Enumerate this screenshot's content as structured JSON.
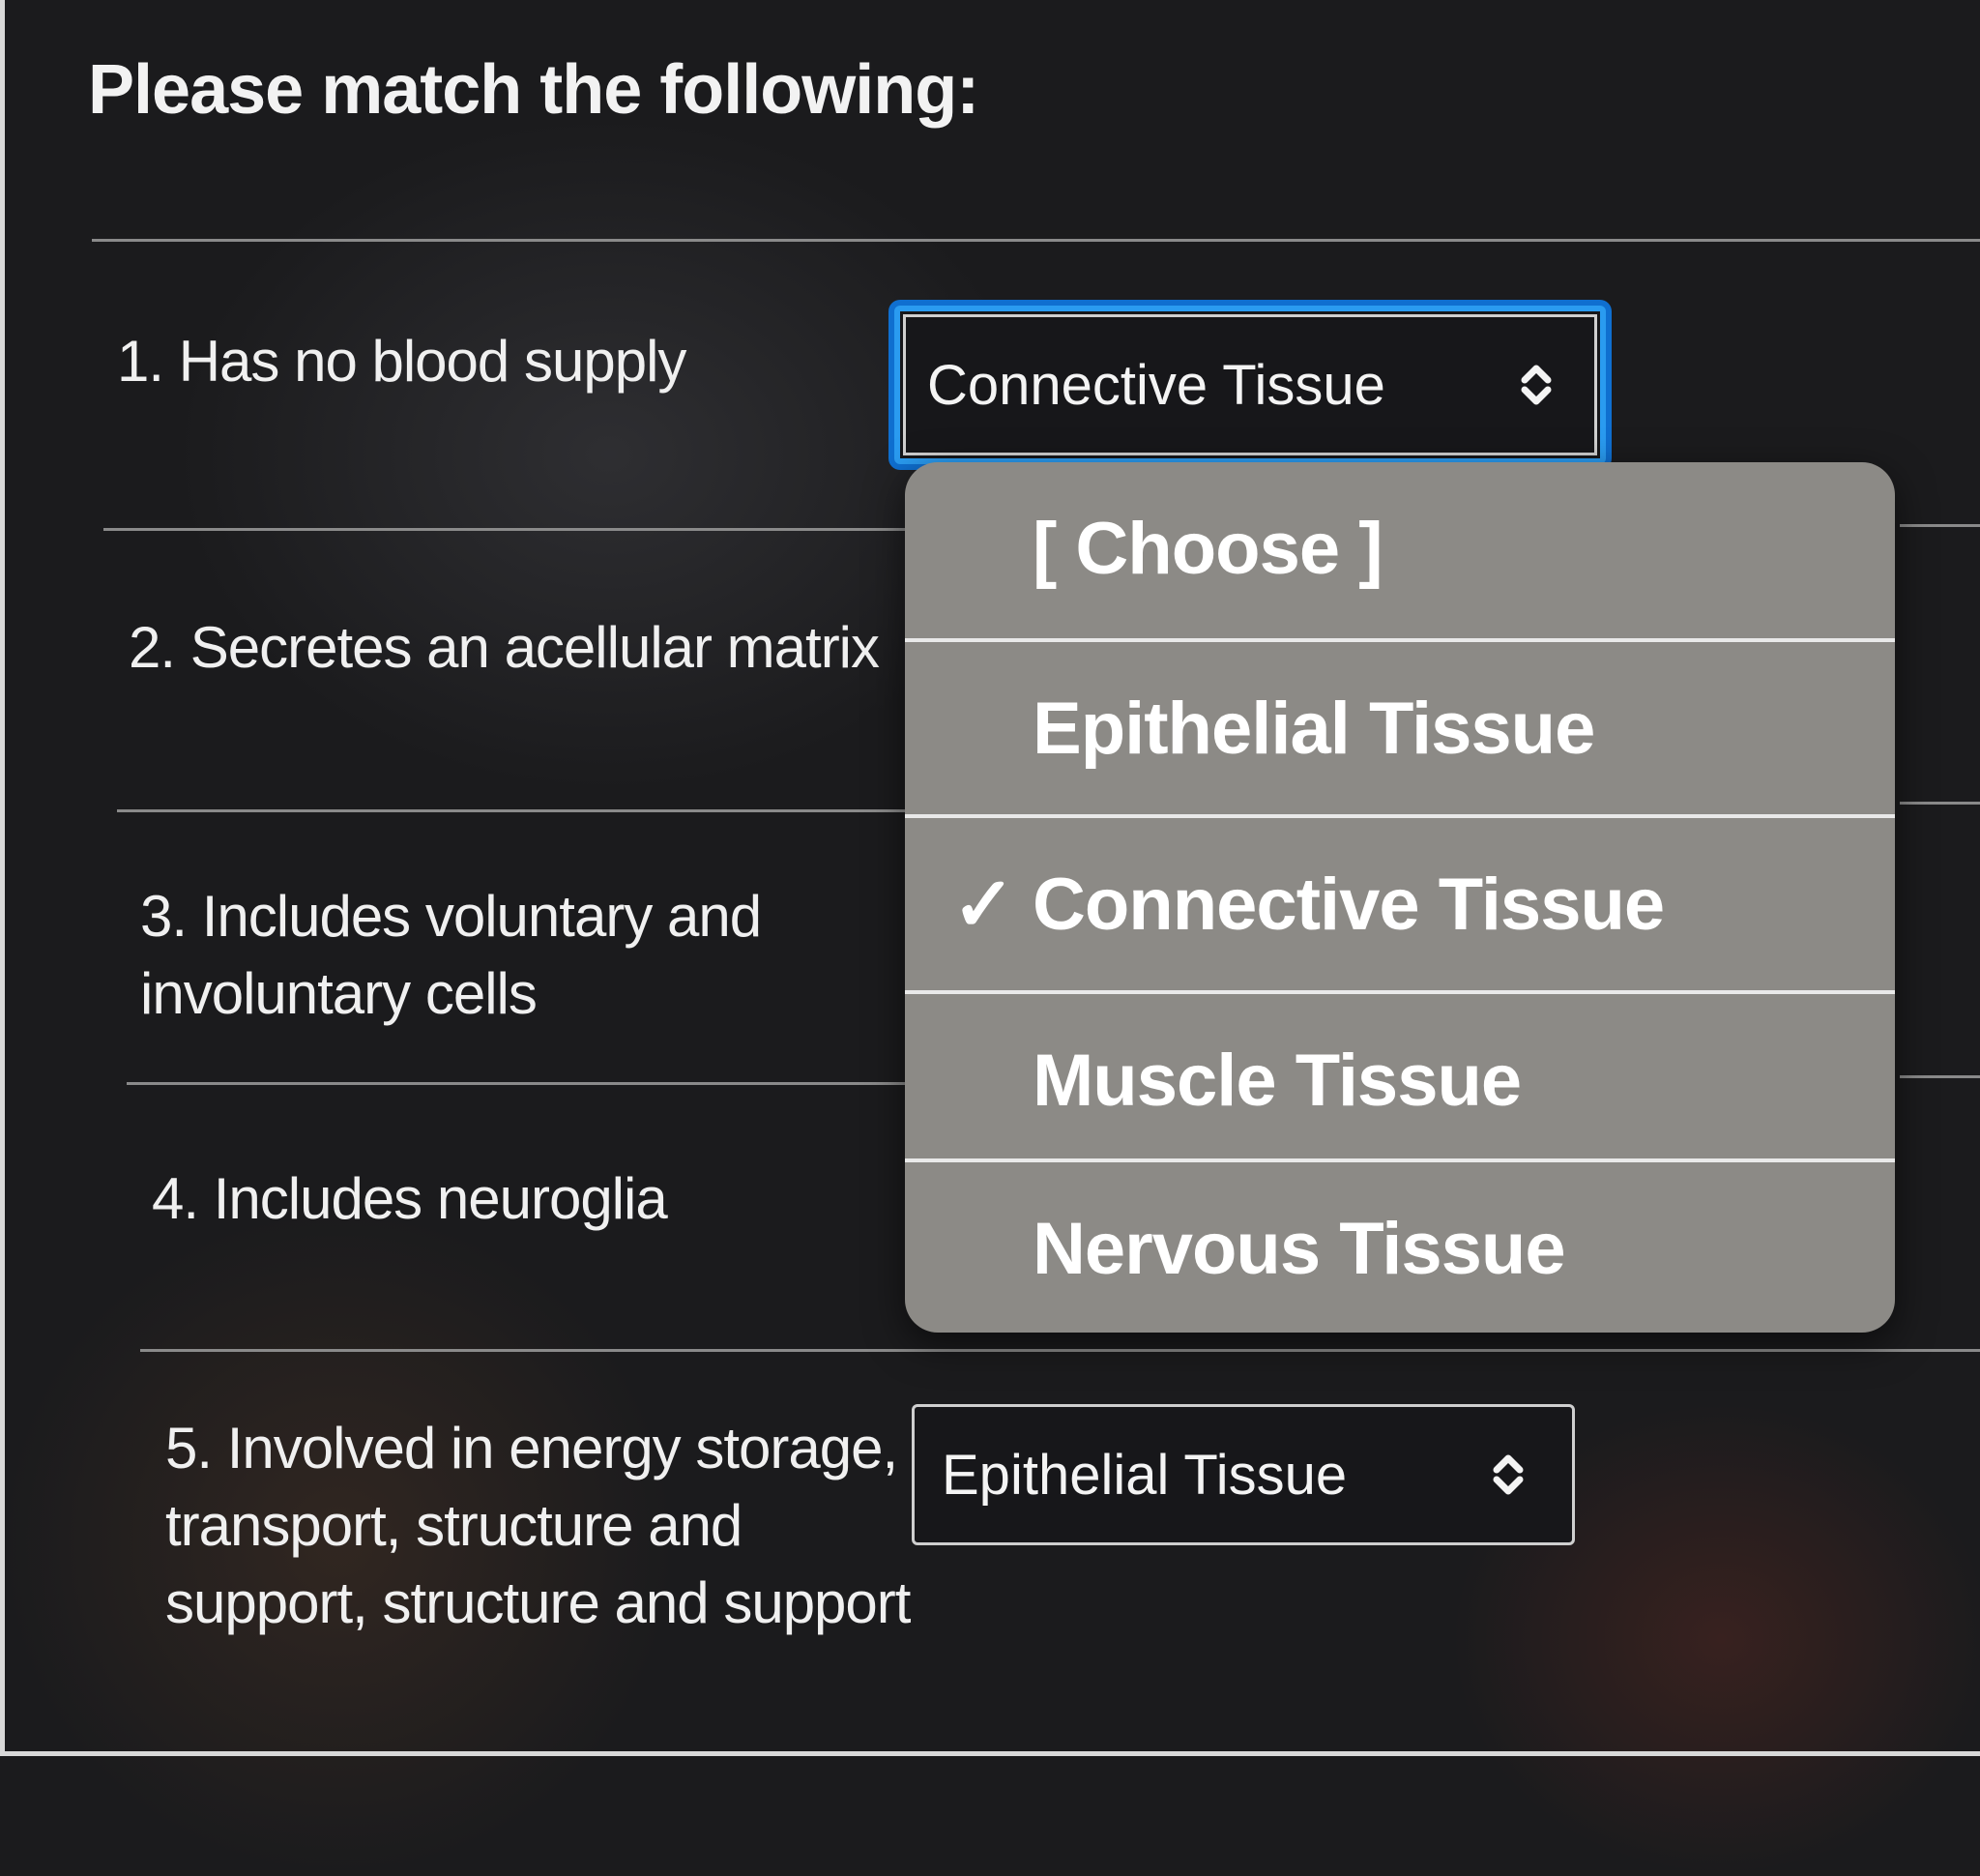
{
  "title": "Please match the following:",
  "questions": [
    {
      "text": "1. Has no blood supply",
      "selected": "Connective Tissue"
    },
    {
      "text": "2. Secretes an acellular matrix"
    },
    {
      "text_line1": "3. Includes voluntary and",
      "text_line2": "involuntary cells"
    },
    {
      "text": "4. Includes neuroglia"
    },
    {
      "text_line1": "5. Involved in energy storage,",
      "text_line2": "transport, structure and",
      "text_line3": "support, structure and support",
      "selected": "Epithelial Tissue"
    }
  ],
  "dropdown": {
    "options": [
      "[ Choose ]",
      "Epithelial Tissue",
      "Connective Tissue",
      "Muscle Tissue",
      "Nervous Tissue"
    ],
    "checked_option": "Connective Tissue",
    "check_glyph": "✓"
  },
  "colors": {
    "focus_ring": "#2a9bf0",
    "menu_background": "#8c8a86"
  }
}
